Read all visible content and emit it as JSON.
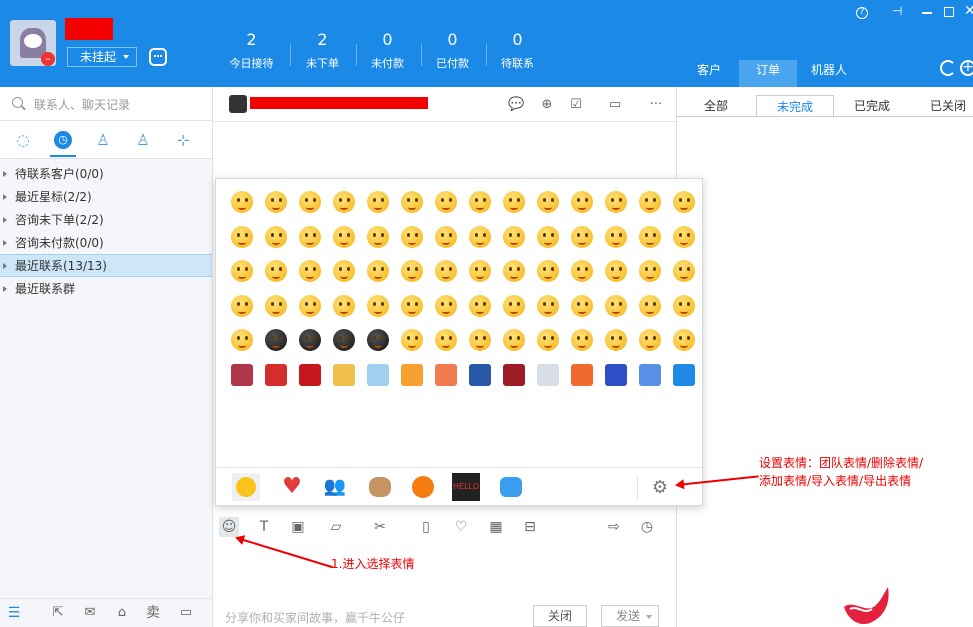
{
  "header": {
    "status_label": "未挂起",
    "stats": [
      {
        "value": "2",
        "label": "今日接待"
      },
      {
        "value": "2",
        "label": "未下单"
      },
      {
        "value": "0",
        "label": "未付款"
      },
      {
        "value": "0",
        "label": "已付款"
      },
      {
        "value": "0",
        "label": "待联系"
      }
    ],
    "right_tabs": [
      "客户",
      "订单",
      "机器人"
    ],
    "window_icons": [
      "help-icon",
      "pin-icon",
      "minimize-icon",
      "maximize-icon",
      "close-icon"
    ]
  },
  "sidebar": {
    "search_placeholder": "联系人、聊天记录",
    "tabs": [
      "chat-icon",
      "recent-icon",
      "contact-icon",
      "group-icon",
      "org-icon"
    ],
    "groups": [
      {
        "label": "待联系客户(0/0)",
        "selected": false
      },
      {
        "label": "最近星标(2/2)",
        "selected": false
      },
      {
        "label": "咨询未下单(2/2)",
        "selected": false
      },
      {
        "label": "咨询未付款(0/0)",
        "selected": false
      },
      {
        "label": "最近联系(13/13)",
        "selected": true
      },
      {
        "label": "最近联系群",
        "selected": false
      }
    ],
    "bottom_icons": [
      "menu-icon",
      "share-icon",
      "mail-icon",
      "shop-icon",
      "sell-icon",
      "window-icon"
    ],
    "sell_label": "卖"
  },
  "chat": {
    "header_icons": [
      "message-icon",
      "add-user-icon",
      "edit-icon",
      "video-icon",
      "more-icon"
    ],
    "more_label": "···",
    "toolbar_icons": [
      "emoji-icon",
      "font-icon",
      "screenshot-icon",
      "folder-icon",
      "scissors-icon",
      "vibrate-icon",
      "heart-icon",
      "calculator-icon",
      "coupon-icon",
      "forward-icon",
      "history-icon"
    ],
    "input_hint": "分享你和买家间故事，赢千牛公仔",
    "close_button": "关闭",
    "send_button": "发送"
  },
  "orders": {
    "tabs": [
      "全部",
      "未完成",
      "已完成",
      "已关闭"
    ],
    "selected_tab": "未完成"
  },
  "emoji_panel": {
    "rows": 6,
    "tabs": [
      "smiley",
      "heart",
      "people",
      "cow",
      "orange",
      "hello",
      "bot"
    ],
    "hello_text": "HELLO",
    "settings_icon": "gear-icon"
  },
  "annotations": {
    "settings_note_line1": "设置表情：团队表情/删除表情/",
    "settings_note_line2": "添加表情/导入表情/导出表情",
    "emoji_note": "1.进入选择表情"
  },
  "colors": {
    "header_blue": "#1b8ae6",
    "selected_row": "#cde6f8",
    "annotation_red": "#e00000"
  }
}
